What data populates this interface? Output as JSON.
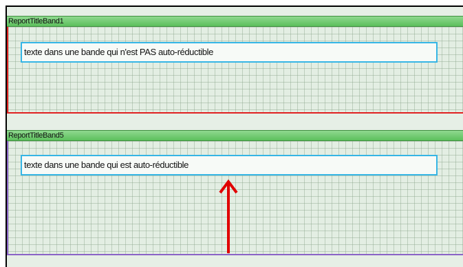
{
  "bands": [
    {
      "title": "ReportTitleBand1",
      "text": "texte dans une bande qui n'est PAS auto-réductible",
      "border_color": "#e02020"
    },
    {
      "title": "ReportTitleBand5",
      "text": "texte dans une bande qui est auto-réductible",
      "border_color": "#8a63c6"
    }
  ],
  "colors": {
    "band_header": "#5cbf5c",
    "textbox_border": "#35b5e5",
    "arrow": "#e00000"
  },
  "icons": {
    "annotation": "red-up-arrow"
  }
}
